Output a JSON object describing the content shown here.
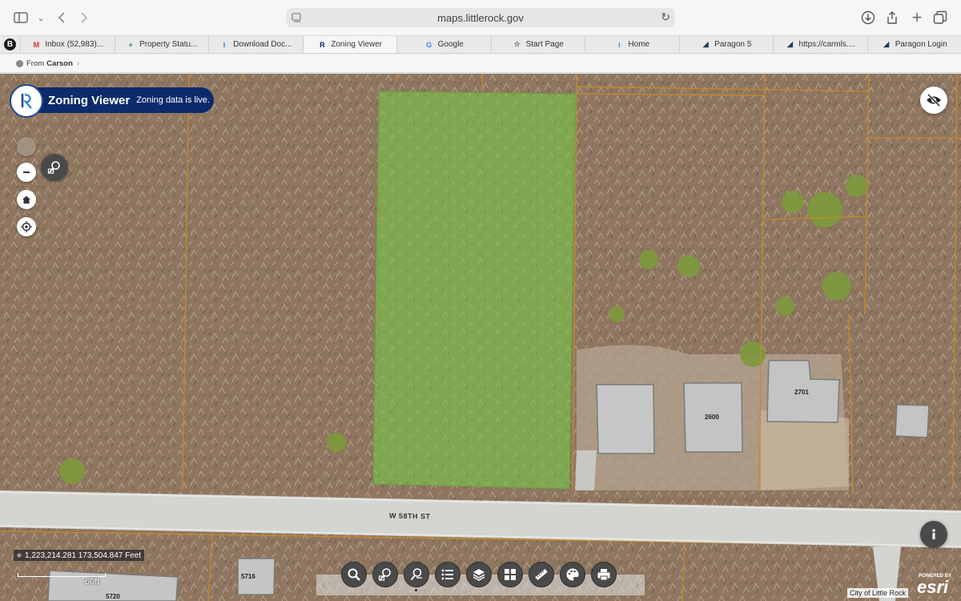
{
  "browser": {
    "url": "maps.littlerock.gov",
    "from_label": "From",
    "from_name": "Carson",
    "tabs": [
      {
        "label": "Inbox (52,983)...",
        "favicon": "gmail-icon",
        "color": "#d93025",
        "glyph": "M"
      },
      {
        "label": "Property Statu...",
        "favicon": "sheets-icon",
        "color": "#1e8e3e",
        "glyph": "+"
      },
      {
        "label": "Download Doc...",
        "favicon": "download-doc-icon",
        "color": "#1a73e8",
        "glyph": "i"
      },
      {
        "label": "Zoning Viewer",
        "favicon": "zoning-viewer-icon",
        "color": "#0d2b6a",
        "glyph": "R",
        "active": true
      },
      {
        "label": "Google",
        "favicon": "google-icon",
        "color": "#4285f4",
        "glyph": "G"
      },
      {
        "label": "Start Page",
        "favicon": "star-icon",
        "color": "#666666",
        "glyph": "☆"
      },
      {
        "label": "Home",
        "favicon": "info-icon",
        "color": "#3b8fd9",
        "glyph": "i"
      },
      {
        "label": "Paragon 5",
        "favicon": "paragon-icon",
        "color": "#1d3b5e",
        "glyph": "◢"
      },
      {
        "label": "https://carmls....",
        "favicon": "paragon-icon",
        "color": "#1d3b5e",
        "glyph": "◢"
      },
      {
        "label": "Paragon Login",
        "favicon": "paragon-icon",
        "color": "#1d3b5e",
        "glyph": "◢"
      }
    ],
    "profile_letter": "B"
  },
  "app": {
    "title": "Zoning Viewer",
    "status": "Zoning data is live."
  },
  "map": {
    "coordinates": "1,223,214.281 173,504.847 Feet",
    "scale_label": "60ft",
    "street_label": "W 58TH ST",
    "building_labels": {
      "b2600": "2600",
      "b2701": "2701",
      "b5716": "5716",
      "b5720": "5720"
    },
    "attribution": "City of Little Rock",
    "powered_by": "POWERED BY",
    "esri": "esri",
    "highlight_color": "#7fb04a"
  },
  "tools": [
    {
      "name": "search-tool",
      "icon": "search-icon"
    },
    {
      "name": "parcel-search-tool",
      "icon": "parcel-search-icon"
    },
    {
      "name": "identify-tool",
      "icon": "identify-icon",
      "active": true
    },
    {
      "name": "legend-tool",
      "icon": "list-icon"
    },
    {
      "name": "layers-tool",
      "icon": "layers-icon"
    },
    {
      "name": "basemap-tool",
      "icon": "grid-icon"
    },
    {
      "name": "measure-tool",
      "icon": "ruler-icon"
    },
    {
      "name": "style-tool",
      "icon": "palette-icon"
    },
    {
      "name": "print-tool",
      "icon": "print-icon"
    }
  ]
}
